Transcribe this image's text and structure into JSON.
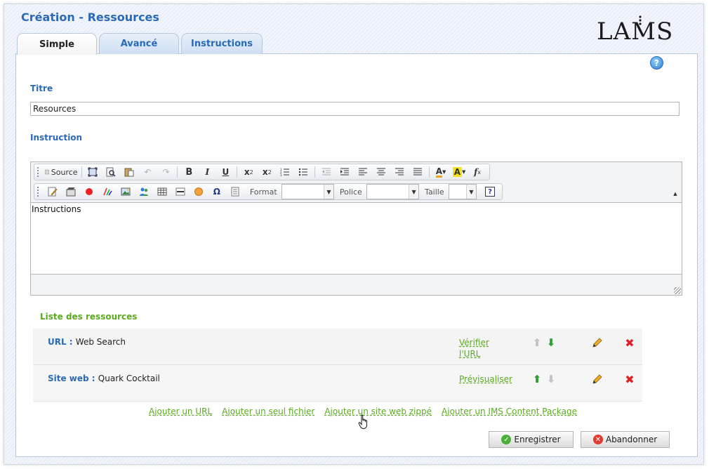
{
  "app": {
    "title": "Création - Ressources",
    "logo": "LAMS"
  },
  "tabs": [
    {
      "label": "Simple",
      "active": true
    },
    {
      "label": "Avancé",
      "active": false
    },
    {
      "label": "Instructions",
      "active": false
    }
  ],
  "help": {
    "icon": "help-icon",
    "glyph": "?"
  },
  "form": {
    "title_label": "Titre",
    "title_value": "Resources",
    "instruction_label": "Instruction"
  },
  "editor": {
    "toolbar": {
      "source_label": "Source",
      "format_label": "Format",
      "font_label": "Police",
      "size_label": "Taille",
      "format_value": "",
      "font_value": "",
      "size_value": ""
    },
    "content": "Instructions"
  },
  "resources": {
    "heading": "Liste des ressources",
    "items": [
      {
        "type": "URL :",
        "name": "Web Search",
        "action_line1": "Vérifier",
        "action_line2": "l'URL",
        "up_enabled": false,
        "down_enabled": true
      },
      {
        "type": "Site web :",
        "name": "Quark Cocktail",
        "action_line1": "Prévisualiser",
        "action_line2": "",
        "up_enabled": true,
        "down_enabled": false
      }
    ]
  },
  "add_links": [
    "Ajouter un URL",
    "Ajouter un seul fichier",
    "Ajouter un site web zippé",
    "Ajouter un IMS Content Package"
  ],
  "buttons": {
    "save": "Enregistrer",
    "cancel": "Abandonner"
  },
  "colors": {
    "accent_blue": "#2a6ab8",
    "accent_green": "#5aab1f",
    "delete_red": "#dd2222"
  }
}
